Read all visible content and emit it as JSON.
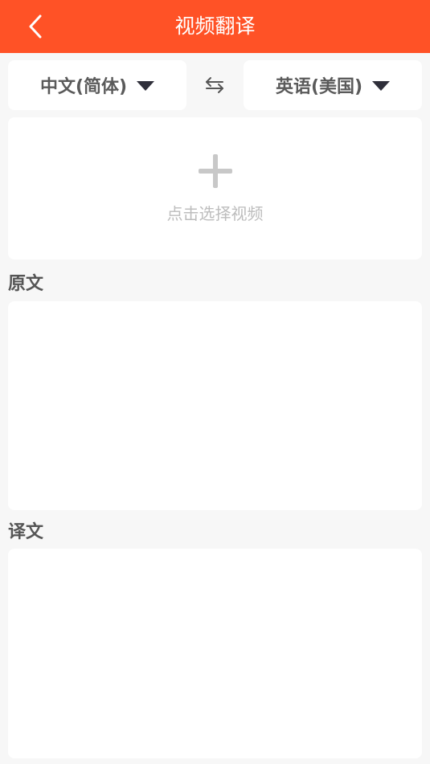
{
  "header": {
    "title": "视频翻译",
    "back_icon": "chevron-left-icon",
    "background": "#ff5226"
  },
  "languages": {
    "source": "中文(简体)",
    "target": "英语(美国)",
    "caret_icon": "caret-down-icon",
    "swap_icon": "swap-arrows-icon"
  },
  "upload": {
    "icon": "plus-icon",
    "label": "点击选择视频"
  },
  "sections": {
    "original_label": "原文",
    "original_text": "",
    "translated_label": "译文",
    "translated_text": ""
  }
}
